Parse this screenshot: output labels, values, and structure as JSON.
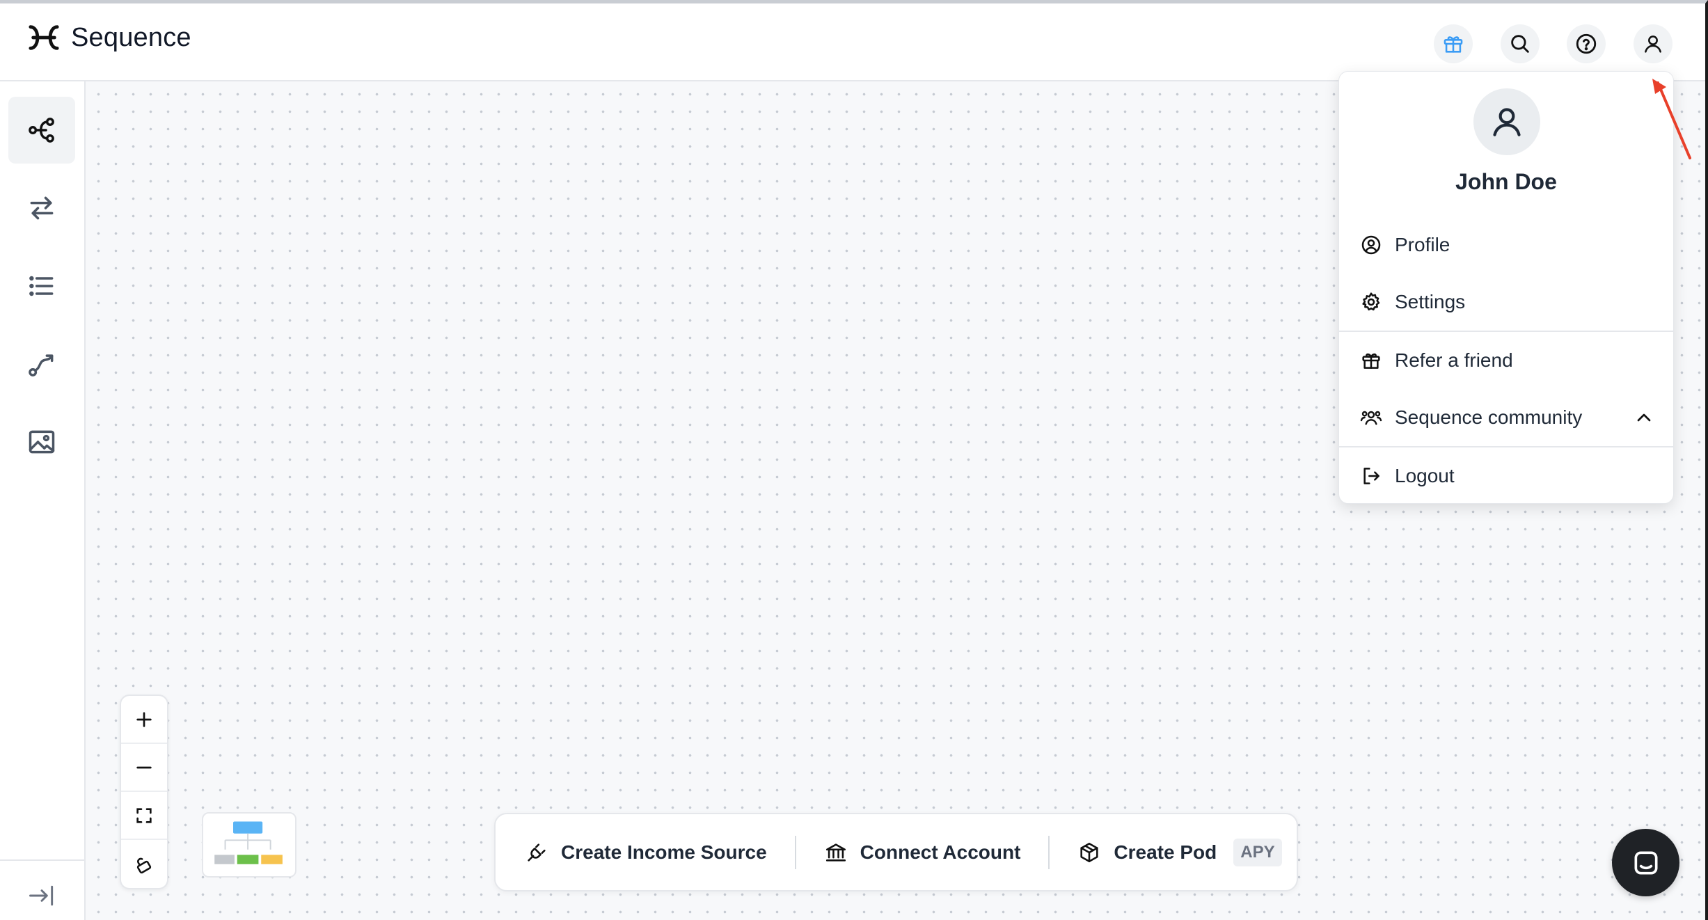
{
  "app": {
    "name": "Sequence"
  },
  "header": {
    "icons": [
      "gift-icon",
      "search-icon",
      "help-icon",
      "user-icon"
    ]
  },
  "sidebar": {
    "items": [
      {
        "icon": "nodes-icon",
        "active": true
      },
      {
        "icon": "transfer-arrows-icon",
        "active": false
      },
      {
        "icon": "list-icon",
        "active": false
      },
      {
        "icon": "route-icon",
        "active": false
      },
      {
        "icon": "image-icon",
        "active": false
      }
    ],
    "collapse_icon": "collapse-icon"
  },
  "canvas": {
    "zoom_controls": [
      "zoom-in-icon",
      "zoom-out-icon",
      "fit-view-icon",
      "lock-icon"
    ]
  },
  "action_bar": {
    "create_income_source": "Create Income Source",
    "connect_account": "Connect Account",
    "create_pod": "Create Pod",
    "apy_badge": "APY"
  },
  "user_menu": {
    "name": "John Doe",
    "profile": "Profile",
    "settings": "Settings",
    "refer": "Refer a friend",
    "community": "Sequence community",
    "logout": "Logout"
  },
  "colors": {
    "gift_accent": "#3b9cf5",
    "annotation_arrow": "#e8402a",
    "chat_bubble": "#1f2226"
  }
}
